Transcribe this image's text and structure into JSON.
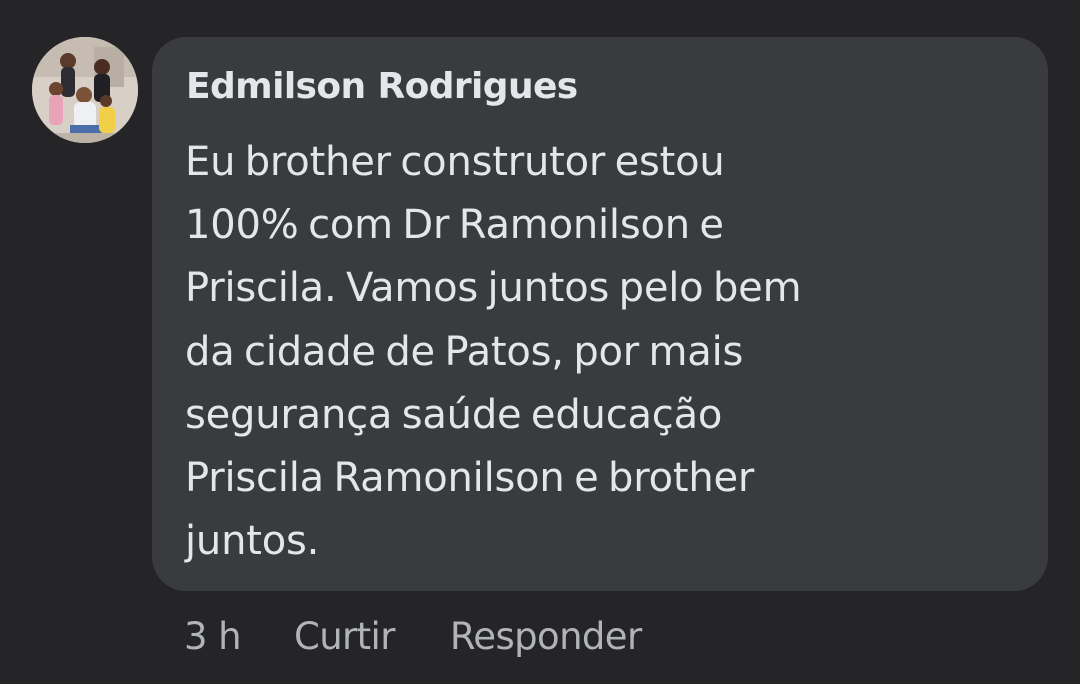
{
  "comment": {
    "author": "Edmilson Rodrigues",
    "avatar_icon": "profile-photo-avatar",
    "text": "Eu brother  construtor  estou\n100%  com Dr Ramonilson  e\nPriscila. Vamos juntos  pelo  bem\nda cidade de Patos,  por mais\nsegurança  saúde  educação\nPriscila  Ramonilson  e brother\njuntos.",
    "timestamp": "3 h",
    "like_label": "Curtir",
    "reply_label": "Responder"
  },
  "colors": {
    "background": "#252527",
    "bubble": "#3a3b3d",
    "primary_text": "#e4e6eb",
    "secondary_text": "#b0b3b8"
  }
}
